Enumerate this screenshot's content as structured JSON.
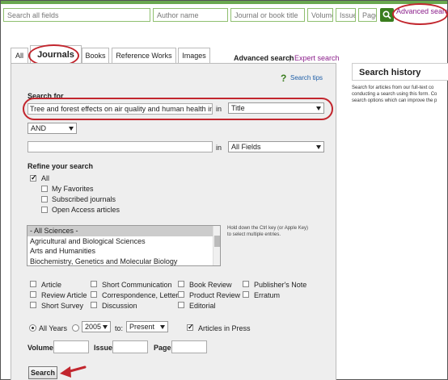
{
  "quick_search": {
    "all_fields_placeholder": "Search all fields",
    "author_placeholder": "Author name",
    "journal_placeholder": "Journal or book title",
    "volume_placeholder": "Volume",
    "issue_placeholder": "Issue",
    "page_placeholder": "Page",
    "advanced_link": "Advanced search"
  },
  "tabs": [
    {
      "label": "All"
    },
    {
      "label": "Journals"
    },
    {
      "label": "Books"
    },
    {
      "label": "Reference Works"
    },
    {
      "label": "Images"
    }
  ],
  "mode_links": {
    "advanced": "Advanced search",
    "separator": "|",
    "expert": "Expert search"
  },
  "search_tips": "Search tips",
  "form": {
    "search_for_label": "Search for",
    "term1_value": "Tree and forest effects on air quality and human health in the U",
    "in_label": "in",
    "field1": "Title",
    "operator": "AND",
    "term2_value": "",
    "field2": "All Fields",
    "refine_label": "Refine your search",
    "refine_options": [
      {
        "label": "All",
        "checked": true
      },
      {
        "label": "My Favorites",
        "checked": false
      },
      {
        "label": "Subscribed journals",
        "checked": false
      },
      {
        "label": "Open Access articles",
        "checked": false
      }
    ],
    "subject_areas": [
      "- All Sciences -",
      "Agricultural and Biological Sciences",
      "Arts and Humanities",
      "Biochemistry, Genetics and Molecular Biology"
    ],
    "multi_select_hint_line1": "Hold down the Ctrl key (or Apple Key)",
    "multi_select_hint_line2": "to select multiple entries.",
    "article_types": {
      "col1": [
        "Article",
        "Review Article",
        "Short Survey"
      ],
      "col2": [
        "Short Communication",
        "Correspondence, Letter",
        "Discussion"
      ],
      "col3": [
        "Book Review",
        "Product Review",
        "Editorial"
      ],
      "col4": [
        "Publisher's Note",
        "Erratum"
      ]
    },
    "all_years_label": "All Years",
    "year_from": "2005",
    "to_label": "to:",
    "year_to": "Present",
    "articles_in_press": "Articles in Press",
    "volume_label": "Volume",
    "issue_label": "Issue",
    "page_label": "Page",
    "search_button": "Search"
  },
  "sidebar": {
    "title": "Search history",
    "lines": [
      "Search for articles from our full-text co",
      "conducting a search using this form. Co",
      "search options which can improve the p"
    ]
  },
  "colors": {
    "brand_green": "#6aa84f",
    "highlight_red": "#c2262e",
    "link_purple": "#8a1d8a"
  }
}
